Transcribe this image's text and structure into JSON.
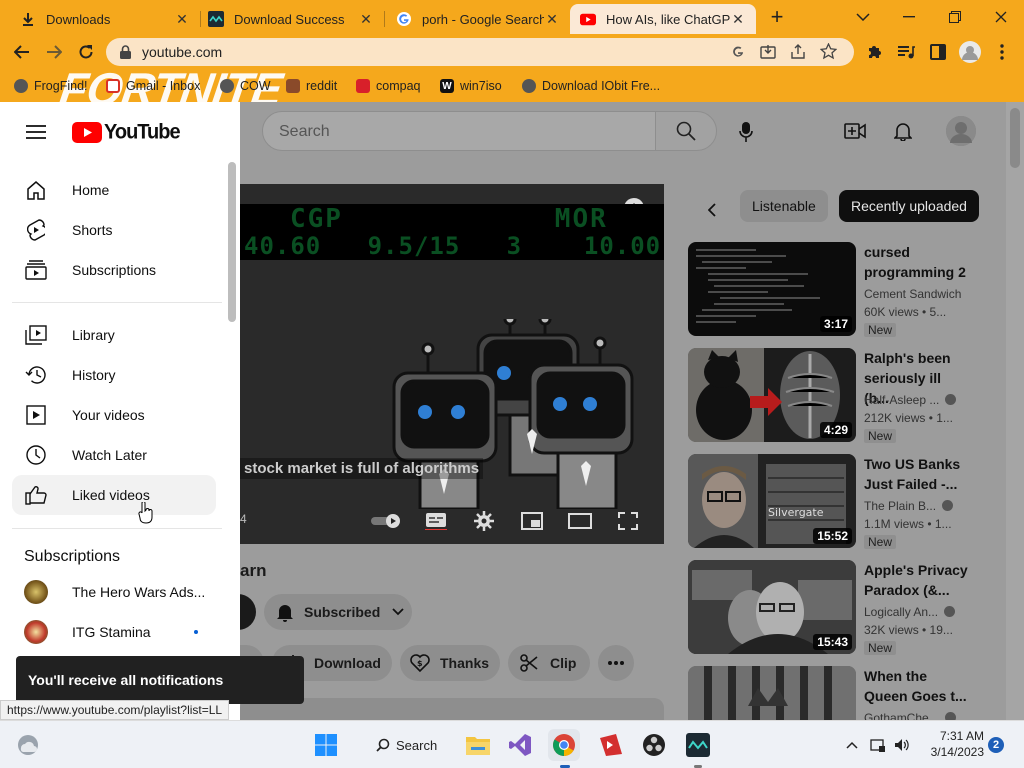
{
  "browser": {
    "tabs": [
      {
        "label": "Downloads",
        "icon": "download-icon",
        "close": "✕"
      },
      {
        "label": "Download Success",
        "icon": "wave-logo-icon",
        "close": "✕"
      },
      {
        "label": "porh - Google Search",
        "icon": "google-g-icon",
        "close": "✕"
      },
      {
        "label": "How AIs, like ChatGPT,",
        "icon": "youtube-icon",
        "close": "✕"
      }
    ],
    "new_tab": "+",
    "url": "youtube.com",
    "bookmarks": [
      {
        "label": "FrogFind!",
        "icon": "globe-icon"
      },
      {
        "label": "Gmail - Inbox",
        "icon": "gmail-icon"
      },
      {
        "label": "COW",
        "icon": "globe-icon"
      },
      {
        "label": "reddit",
        "icon": "reddit-icon"
      },
      {
        "label": "compaq",
        "icon": "compaq-icon"
      },
      {
        "label": "win7iso",
        "icon": "w-icon"
      },
      {
        "label": "Download IObit Fre...",
        "icon": "globe-icon"
      }
    ],
    "bookmark_banner": "FORTNITE",
    "status_url": "https://www.youtube.com/playlist?list=LL"
  },
  "youtube": {
    "logo_text": "YouTube",
    "search_placeholder": "Search",
    "sidebar": {
      "main": [
        {
          "label": "Home",
          "icon": "home-icon"
        },
        {
          "label": "Shorts",
          "icon": "shorts-icon"
        },
        {
          "label": "Subscriptions",
          "icon": "subscriptions-icon"
        }
      ],
      "library": [
        {
          "label": "Library",
          "icon": "library-icon"
        },
        {
          "label": "History",
          "icon": "history-icon"
        },
        {
          "label": "Your videos",
          "icon": "your-videos-icon"
        },
        {
          "label": "Watch Later",
          "icon": "watch-later-icon"
        },
        {
          "label": "Liked videos",
          "icon": "thumbs-up-icon"
        }
      ],
      "subscriptions_heading": "Subscriptions",
      "subscriptions": [
        {
          "label": "The Hero Wars Ads...",
          "new": false
        },
        {
          "label": "ITG Stamina",
          "new": true
        }
      ]
    },
    "video": {
      "ticker_row1": "CGP            MOR",
      "ticker_row2": "40.60   9.5/15   3    10.00",
      "caption": "stock market is full of algorithms",
      "time_fragment": "4",
      "title_fragment": "arn",
      "subscribed_label": "Subscribed",
      "actions": [
        {
          "label": "Download",
          "icon": "download-icon"
        },
        {
          "label": "Thanks",
          "icon": "thanks-icon"
        },
        {
          "label": "Clip",
          "icon": "clip-icon"
        }
      ]
    },
    "chips": [
      {
        "label": "Listenable",
        "active": false
      },
      {
        "label": "Recently uploaded",
        "active": true
      }
    ],
    "related": [
      {
        "title": "cursed programming 2",
        "channel": "Cement Sandwich",
        "views": "60K views • 5...",
        "duration": "3:17",
        "badge": "New",
        "verified": false
      },
      {
        "title": "Ralph's been seriously ill (b...",
        "channel": "Half-Asleep ...",
        "views": "212K views • 1...",
        "duration": "4:29",
        "badge": "New",
        "verified": true
      },
      {
        "title": "Two US Banks Just Failed -...",
        "channel": "The Plain B...",
        "views": "1.1M views • 1...",
        "duration": "15:52",
        "badge": "New",
        "verified": true
      },
      {
        "title": "Apple's Privacy Paradox (&...",
        "channel": "Logically An...",
        "views": "32K views • 19...",
        "duration": "15:43",
        "badge": "New",
        "verified": true
      },
      {
        "title": "When the Queen Goes t...",
        "channel": "GothamChe...",
        "views": "",
        "duration": "",
        "badge": "",
        "verified": true
      }
    ],
    "toast": "You'll receive all notifications"
  },
  "taskbar": {
    "search_label": "Search",
    "time": "7:31 AM",
    "date": "3/14/2023",
    "notification_count": "2"
  },
  "colors": {
    "browser_frame": "#f5a81c",
    "youtube_red": "#ff0000",
    "page_dim": "#9c9c9c"
  }
}
